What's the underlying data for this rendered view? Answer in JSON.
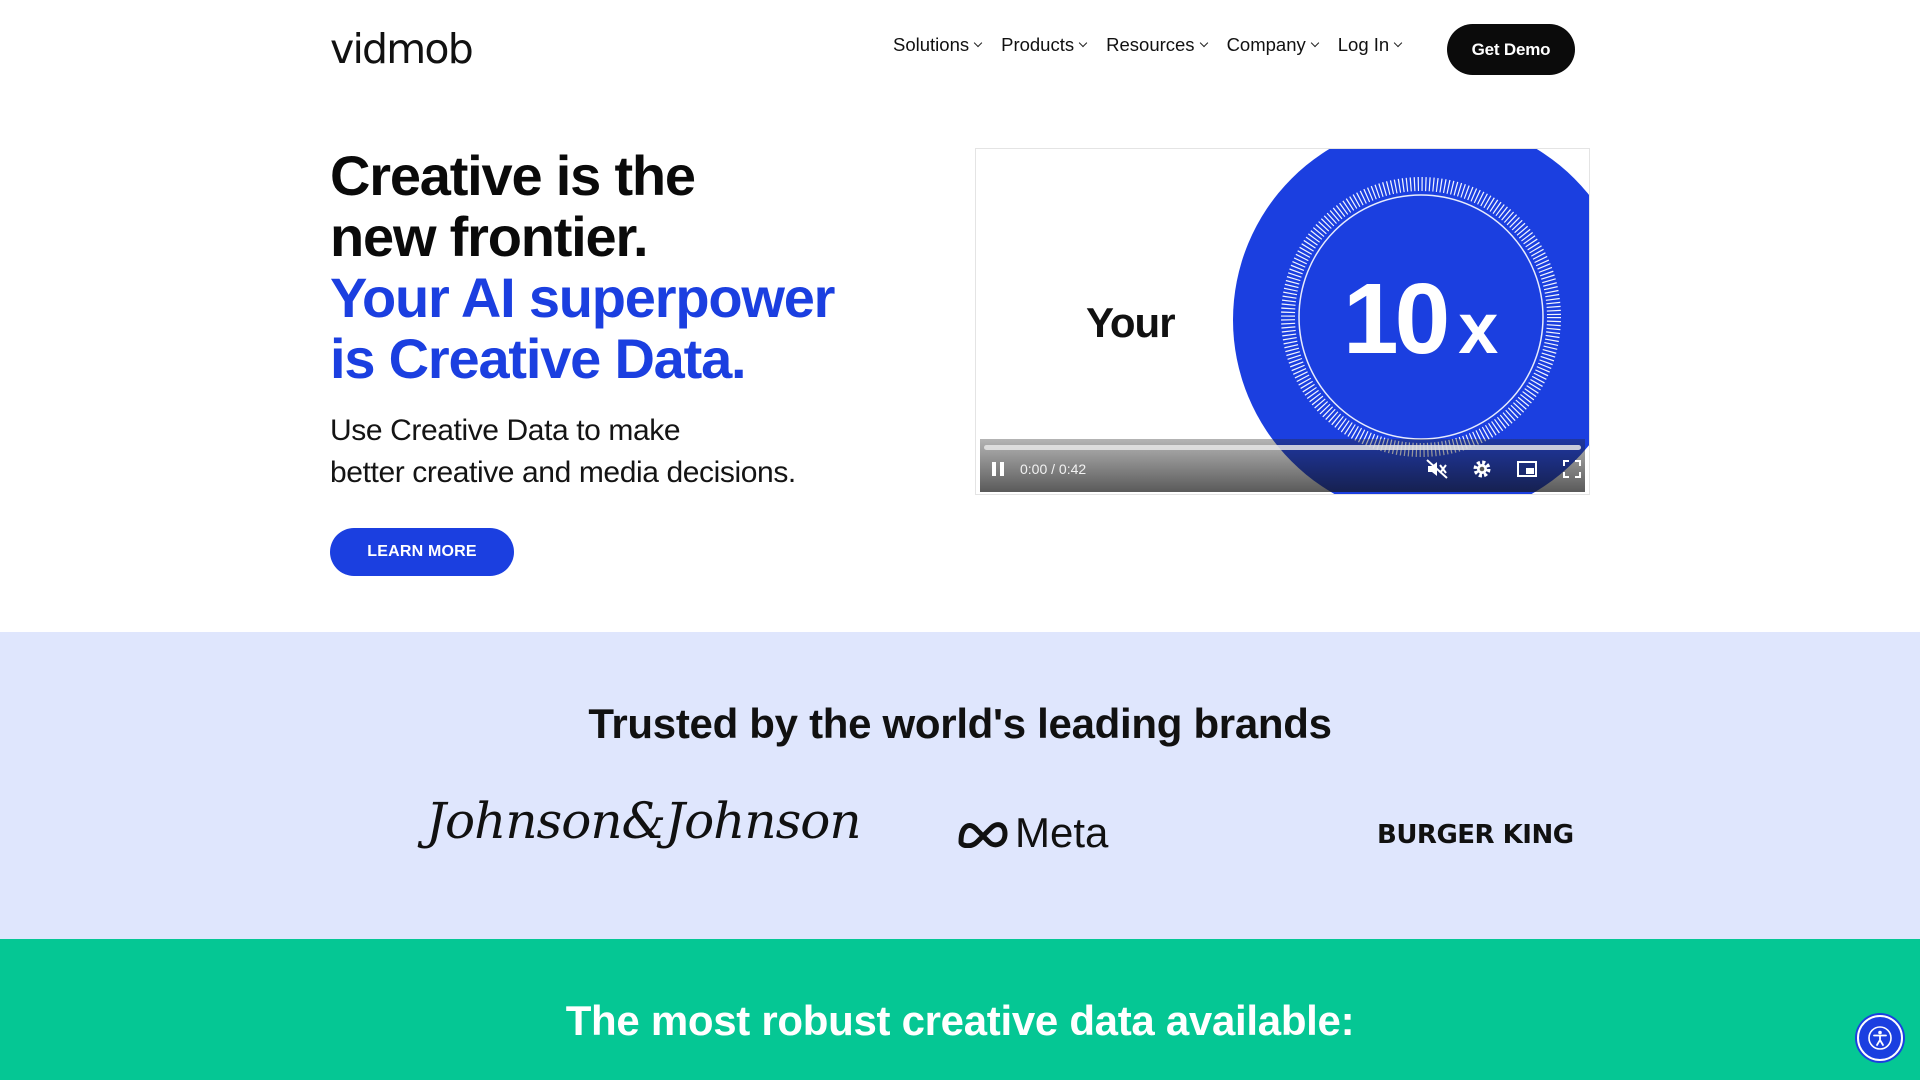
{
  "brand": {
    "logo_text": "vidmob"
  },
  "nav": {
    "items": [
      {
        "label": "Solutions"
      },
      {
        "label": "Products"
      },
      {
        "label": "Resources"
      },
      {
        "label": "Company"
      },
      {
        "label": "Log In"
      }
    ],
    "cta_label": "Get Demo"
  },
  "hero": {
    "title_black_1": "Creative is the",
    "title_black_2": "new frontier.",
    "title_blue_1": "Your AI superpower",
    "title_blue_2": "is Creative Data.",
    "subtitle_1": "Use Creative Data to make",
    "subtitle_2": "better creative and media decisions.",
    "button_label": "LEARN MORE"
  },
  "video": {
    "frame_text_left": "Your",
    "frame_text_number": "10",
    "frame_text_suffix": "x",
    "timecode": "0:00 / 0:42",
    "progress": 0.0,
    "state": "playing",
    "muted": true,
    "icons": [
      "pause-icon",
      "mute-icon",
      "settings-icon",
      "picture-in-picture-icon",
      "fullscreen-icon"
    ]
  },
  "brands": {
    "title": "Trusted by the world's leading brands",
    "logos": [
      "Johnson & Johnson",
      "Meta",
      "BURGER KING"
    ],
    "jj_text": "Johnson&Johnson",
    "meta_text": "Meta",
    "bk_text": "BURGER KING"
  },
  "data_section": {
    "title": "The most robust creative data available:"
  },
  "colors": {
    "accent_blue": "#1b3fe0",
    "brands_bg": "#dfe6fd",
    "green_bg": "#05c794",
    "dark": "#0b0b0b"
  }
}
